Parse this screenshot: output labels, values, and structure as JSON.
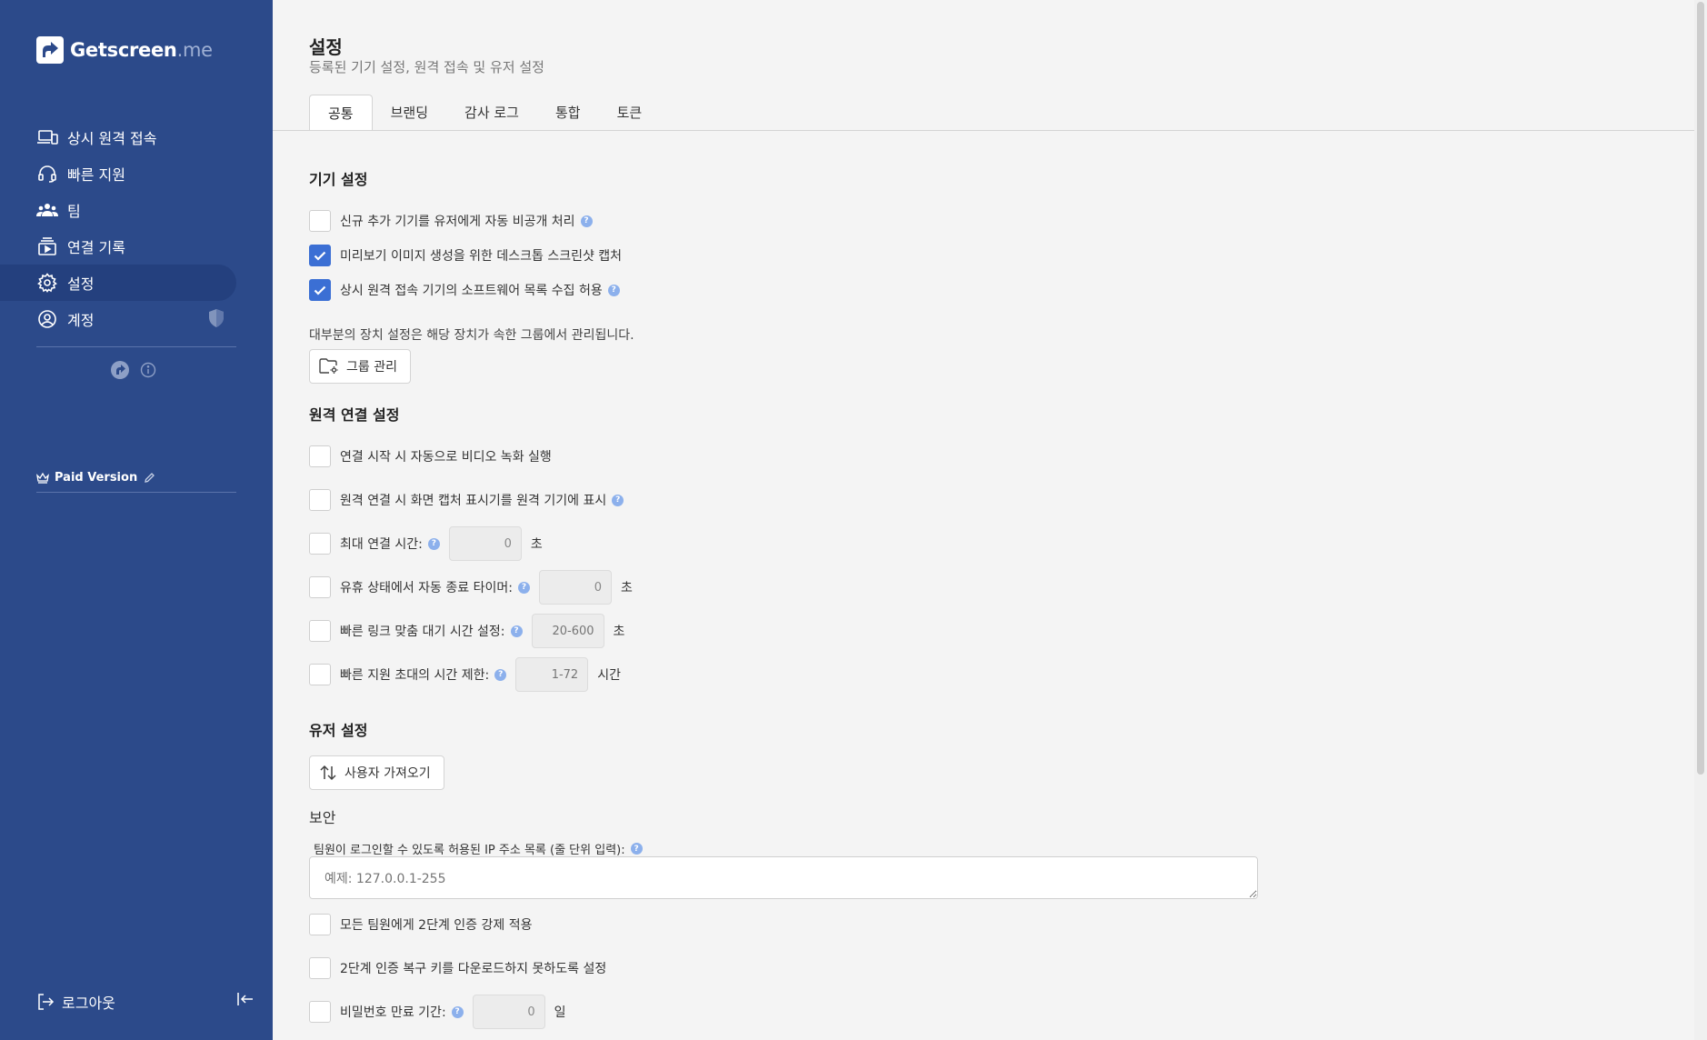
{
  "app": {
    "brand": "Getscreen",
    "brand_suffix": ".me"
  },
  "sidebar": {
    "items": [
      {
        "label": "상시 원격 접속",
        "icon": "devices-icon"
      },
      {
        "label": "빠른 지원",
        "icon": "headset-icon"
      },
      {
        "label": "팀",
        "icon": "team-icon"
      },
      {
        "label": "연결 기록",
        "icon": "history-icon"
      },
      {
        "label": "설정",
        "icon": "gear-icon",
        "active": true
      },
      {
        "label": "계정",
        "icon": "user-circle-icon"
      }
    ],
    "plan": "Paid Version",
    "logout": "로그아웃"
  },
  "page": {
    "title": "설정",
    "subtitle": "등록된 기기 설정, 원격 접속 및 유저 설정"
  },
  "tabs": [
    {
      "label": "공통",
      "active": true
    },
    {
      "label": "브랜딩"
    },
    {
      "label": "감사 로그"
    },
    {
      "label": "통합"
    },
    {
      "label": "토큰"
    }
  ],
  "device_settings": {
    "title": "기기 설정",
    "options": [
      {
        "label": "신규 추가 기기를 유저에게 자동 비공개 처리",
        "checked": false,
        "help": true
      },
      {
        "label": "미리보기 이미지 생성을 위한 데스크톱 스크린샷 캡처",
        "checked": true,
        "help": false
      },
      {
        "label": "상시 원격 접속 기기의 소프트웨어 목록 수집 허용",
        "checked": true,
        "help": true
      }
    ],
    "note": "대부분의 장치 설정은 해당 장치가 속한 그룹에서 관리됩니다.",
    "manage_groups_button": "그룹 관리"
  },
  "remote_settings": {
    "title": "원격 연결 설정",
    "options": [
      {
        "label": "연결 시작 시 자동으로 비디오 녹화 실행",
        "checked": false
      },
      {
        "label": "원격 연결 시 화면 캡처 표시기를 원격 기기에 표시",
        "checked": false,
        "help": true
      },
      {
        "label": "최대 연결 시간:",
        "checked": false,
        "help": true,
        "value": "0",
        "unit": "초"
      },
      {
        "label": "유휴 상태에서 자동 종료 타이머:",
        "checked": false,
        "help": true,
        "value": "0",
        "unit": "초"
      },
      {
        "label": "빠른 링크 맞춤 대기 시간 설정:",
        "checked": false,
        "help": true,
        "placeholder": "20-600",
        "unit": "초"
      },
      {
        "label": "빠른 지원 초대의 시간 제한:",
        "checked": false,
        "help": true,
        "placeholder": "1-72",
        "unit": "시간"
      }
    ]
  },
  "user_settings": {
    "title": "유저 설정",
    "import_button": "사용자 가져오기",
    "security_label": "보안",
    "ip_label": "팀원이 로그인할 수 있도록 허용된 IP 주소 목록 (줄 단위 입력):",
    "ip_placeholder": "예제: 127.0.0.1-255",
    "options": [
      {
        "label": "모든 팀원에게 2단계 인증 강제 적용",
        "checked": false
      },
      {
        "label": "2단계 인증 복구 키를 다운로드하지 못하도록 설정",
        "checked": false
      },
      {
        "label": "비밀번호 만료 기간:",
        "checked": false,
        "help": true,
        "value": "0",
        "unit": "일"
      }
    ]
  },
  "colors": {
    "sidebar": "#2c4a8a",
    "sidebar_active": "#24407e",
    "accent": "#3b6fd4",
    "help": "#8cb0ec",
    "background": "#f4f4f4"
  }
}
